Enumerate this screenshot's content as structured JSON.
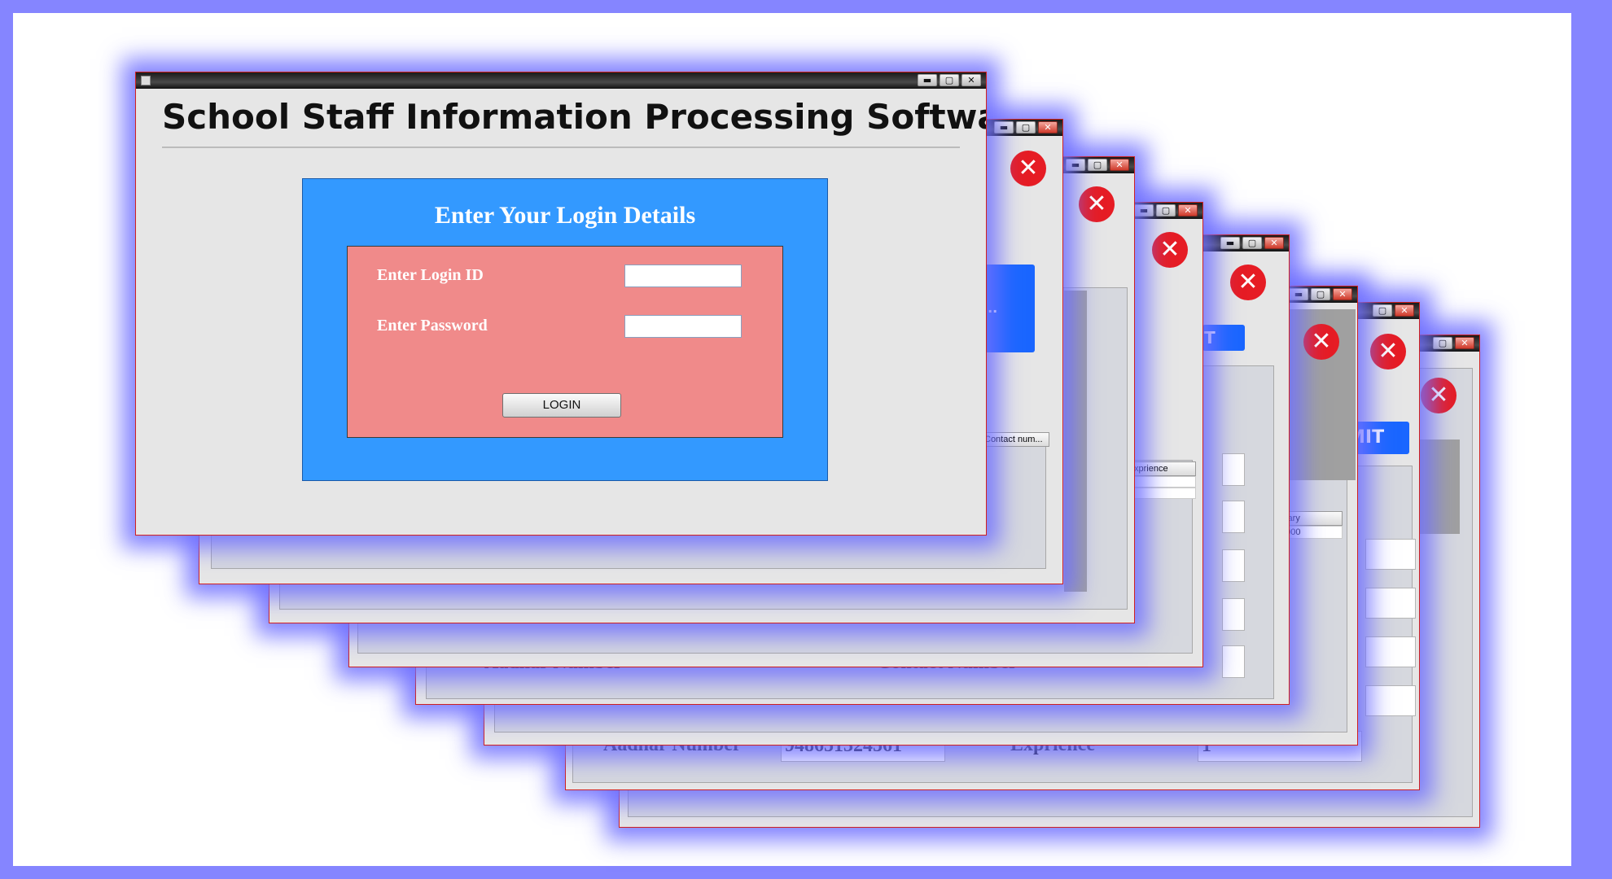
{
  "main_window": {
    "title": "School Staff Information Processing Software",
    "panel_heading": "Enter Your Login Details",
    "login_id_label": "Enter Login ID",
    "login_id_value": "",
    "password_label": "Enter Password",
    "password_value": "",
    "login_button": "LOGIN"
  },
  "background_windows": {
    "w1_button_label": "...",
    "w1_table_header": "Contact num...",
    "w3_table_header": "xprience",
    "w4_button_label": "T",
    "w5_table_header": "alary",
    "w5_table_cell": "0000",
    "w6_button_label": "MIT",
    "w4_hidden_label_1": "Aadhar Number",
    "w4_hidden_label_2": "Contact Number",
    "aadhar_label": "Aadhar Number",
    "aadhar_value": "948651324561",
    "exprience_label": "Exprience",
    "exprience_value": "1"
  },
  "titlebar_glyphs": {
    "minimize": "▬",
    "maximize": "▢",
    "close": "✕"
  },
  "close_circle_glyph": "✕",
  "colors": {
    "page_border": "#8585ff",
    "login_panel": "#3399ff",
    "login_inner": "#f08a8a",
    "submit_blue": "#1a66ff",
    "close_red": "#e61c24"
  }
}
